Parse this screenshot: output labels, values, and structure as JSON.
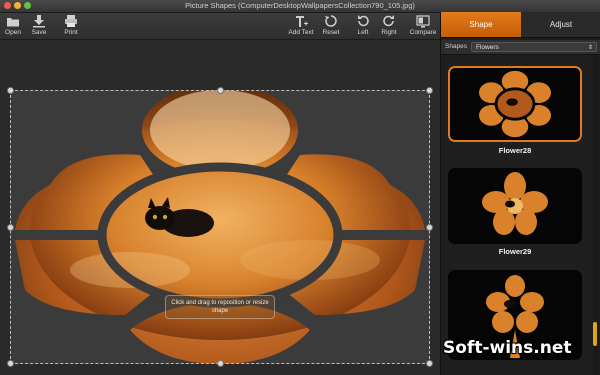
{
  "window": {
    "title": "Picture Shapes (ComputerDesktopWallpapersCollection790_105.jpg)",
    "traffic_colors": [
      "#ee5b52",
      "#f2b330",
      "#5fc54a"
    ]
  },
  "toolbar": {
    "buttons": [
      {
        "label": "Open",
        "icon": "folder-icon"
      },
      {
        "label": "Save",
        "icon": "save-icon"
      },
      {
        "label": "Print",
        "icon": "printer-icon"
      },
      {
        "label": "Add Text",
        "icon": "add-text-icon"
      },
      {
        "label": "Reset",
        "icon": "reset-icon"
      },
      {
        "label": "Left",
        "icon": "rotate-left-icon"
      },
      {
        "label": "Right",
        "icon": "rotate-right-icon"
      },
      {
        "label": "Compare",
        "icon": "compare-icon"
      }
    ]
  },
  "canvas": {
    "hint": "Click and drag to reposition or resize shape"
  },
  "panel": {
    "tabs": [
      {
        "label": "Shape",
        "active": true
      },
      {
        "label": "Adjust",
        "active": false
      }
    ],
    "shapes_label": "Shapes",
    "shapes_selected": "Flowers",
    "items": [
      {
        "name": "Flower28",
        "selected": true
      },
      {
        "name": "Flower29",
        "selected": false
      },
      {
        "name": "",
        "selected": false
      }
    ]
  },
  "watermark": "Soft-wins.net",
  "colors": {
    "accent": "#e37a1a",
    "photo_orange": "#d9822b",
    "overlay": "#3b3b3b"
  }
}
